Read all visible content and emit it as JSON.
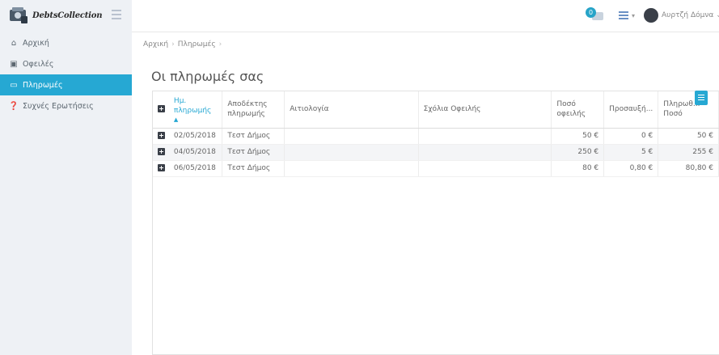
{
  "app": {
    "brand": "DebtsCollection"
  },
  "header": {
    "notifications_count": "0",
    "user_name": "Αυρτζή Δόμνα",
    "user_caret": "⌄"
  },
  "sidebar": {
    "items": [
      {
        "label": "Αρχική",
        "icon": "home-icon"
      },
      {
        "label": "Οφειλές",
        "icon": "money-icon"
      },
      {
        "label": "Πληρωμές",
        "icon": "credit-card-icon",
        "active": true
      },
      {
        "label": "Συχνές Ερωτήσεις",
        "icon": "question-circle-icon"
      }
    ]
  },
  "breadcrumb": {
    "home": "Αρχική",
    "current": "Πληρωμές"
  },
  "page": {
    "title": "Οι πληρωμές σας"
  },
  "table": {
    "headers": {
      "date": "Ημ. πληρωμής",
      "recipient": "Αποδέκτης πληρωμής",
      "reason": "Αιτιολογία",
      "comments": "Σχόλια Οφειλής",
      "debt_amount": "Ποσό οφειλής",
      "surcharge": "Προσαυξή...",
      "paid_amount": "Πληρωθ... Ποσό"
    },
    "rows": [
      {
        "date": "02/05/2018",
        "recipient": "Τεστ Δήμος",
        "reason": "",
        "comments": "",
        "debt_amount": "50 €",
        "surcharge": "0 €",
        "paid_amount": "50 €"
      },
      {
        "date": "04/05/2018",
        "recipient": "Τεστ Δήμος",
        "reason": "",
        "comments": "",
        "debt_amount": "250 €",
        "surcharge": "5 €",
        "paid_amount": "255 €"
      },
      {
        "date": "06/05/2018",
        "recipient": "Τεστ Δήμος",
        "reason": "",
        "comments": "",
        "debt_amount": "80 €",
        "surcharge": "0,80 €",
        "paid_amount": "80,80 €"
      }
    ]
  },
  "colors": {
    "accent": "#26a8d3",
    "sidebar_bg": "#eef1f5"
  }
}
